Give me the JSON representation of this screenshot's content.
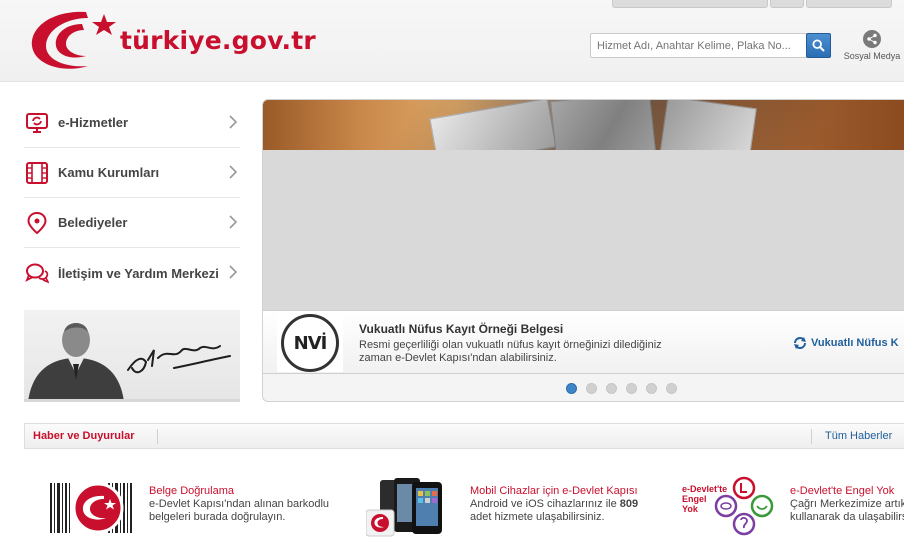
{
  "header": {
    "site_name": "türkiye.gov.tr",
    "search_placeholder": "Hizmet Adı, Anahtar Kelime, Plaka No...",
    "social_label": "Sosyal Medya"
  },
  "menu": {
    "items": [
      {
        "label": "e-Hizmetler",
        "icon": "monitor-icon"
      },
      {
        "label": "Kamu Kurumları",
        "icon": "building-icon"
      },
      {
        "label": "Belediyeler",
        "icon": "map-pin-icon"
      },
      {
        "label": "İletişim ve Yardım Merkezi",
        "icon": "chat-bubbles-icon"
      }
    ]
  },
  "banner": {
    "title": "Vukuatlı Nüfus Kayıt Örneği Belgesi",
    "description": "Resmi geçerliliği olan vukuatlı nüfus kayıt örneğinizi dilediğiniz zaman e-Devlet Kapısı'ndan alabilirsiniz.",
    "link_label": "Vukuatlı Nüfus K",
    "logo_text": "NVİ",
    "slide_count": 6,
    "active_slide": 1
  },
  "news": {
    "title": "Haber ve Duyurular",
    "all_label": "Tüm Haberler"
  },
  "features": [
    {
      "title": "Belge Doğrulama",
      "desc_line1": "e-Devlet Kapısı'ndan alınan barkodlu",
      "desc_line2": "belgeleri burada doğrulayın."
    },
    {
      "title": "Mobil Cihazlar için e-Devlet Kapısı",
      "desc_line1_a": "Android ve iOS cihazlarınız ile ",
      "desc_line1_b": "809",
      "desc_line2": "adet hizmete ulaşabilirsiniz."
    },
    {
      "title": "e-Devlet'te Engel Yok",
      "desc_line1": "Çağrı Merkezimize artık",
      "desc_line2": "kullanarak da ulaşabilirs",
      "logo_line1": "e-Devlet'te",
      "logo_line2": "Engel",
      "logo_line3": "Yok"
    }
  ],
  "colors": {
    "brand_red": "#c8102e",
    "link_blue": "#1f5f9b",
    "active_dot": "#3f86c8"
  }
}
